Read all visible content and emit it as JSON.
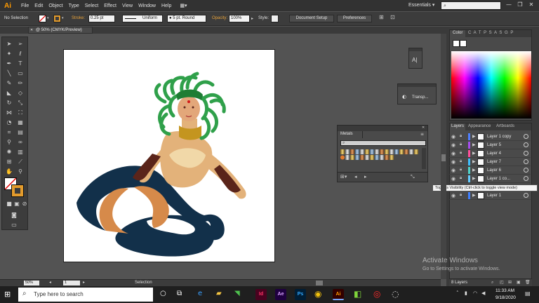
{
  "app": {
    "logo": "Ai"
  },
  "menu": [
    "File",
    "Edit",
    "Object",
    "Type",
    "Select",
    "Effect",
    "View",
    "Window",
    "Help"
  ],
  "workspace": {
    "label": "Essentials",
    "arrow": "▾"
  },
  "window_controls": [
    "—",
    "❐",
    "✕"
  ],
  "control_bar": {
    "selection_label": "No Selection",
    "stroke_label": "Stroke:",
    "stroke_value": "0.25 pt",
    "profile": "Uniform",
    "brush": "5 pt. Round",
    "opacity_label": "Opacity:",
    "opacity_value": "100%",
    "style_label": "Style:",
    "document_setup": "Document Setup",
    "preferences": "Preferences"
  },
  "document": {
    "tab_title": "@ 50% (CMYK/Preview)",
    "close": "✕"
  },
  "artboard_labels": {
    "ai_badge": "A|"
  },
  "transparency_panel": {
    "title": "Transp..."
  },
  "metals_panel": {
    "title": "Metals",
    "close": "✕"
  },
  "color_panel": {
    "title": "Color",
    "tab2": "C A T P S A S G P"
  },
  "layers_panel": {
    "tabs": [
      "Layers",
      "Appearance",
      "Artboards"
    ],
    "layers": [
      {
        "name": "Layer 1 copy",
        "color": "#4f7fff"
      },
      {
        "name": "Layer 5",
        "color": "#a64df0"
      },
      {
        "name": "Layer 4",
        "color": "#ff4f9a"
      },
      {
        "name": "Layer 7",
        "color": "#3fbfff"
      },
      {
        "name": "Layer 6",
        "color": "#4fd3c8"
      },
      {
        "name": "Layer 1 co...",
        "color": "#66ccff"
      },
      {
        "name": "Layer 1",
        "color": "#3f7fff"
      }
    ],
    "tooltip": "Toggles Visibility (Ctrl-click to toggle view mode)",
    "count": "8 Layers"
  },
  "status_bar": {
    "zoom": "50%",
    "page": "1",
    "tool": "Selection"
  },
  "watermark": {
    "line1": "Activate Windows",
    "line2": "Go to Settings to activate Windows."
  },
  "taskbar": {
    "search_placeholder": "Type here to search",
    "time": "11:33 AM",
    "date": "9/18/2020",
    "apps": [
      {
        "label": "Id",
        "bg": "#49021f",
        "fg": "#ff3366"
      },
      {
        "label": "Ae",
        "bg": "#1f0040",
        "fg": "#d8a0ff"
      },
      {
        "label": "Ps",
        "bg": "#001e36",
        "fg": "#31a8ff"
      },
      {
        "label": "Ai",
        "bg": "#330000",
        "fg": "#ff9a00"
      }
    ]
  }
}
